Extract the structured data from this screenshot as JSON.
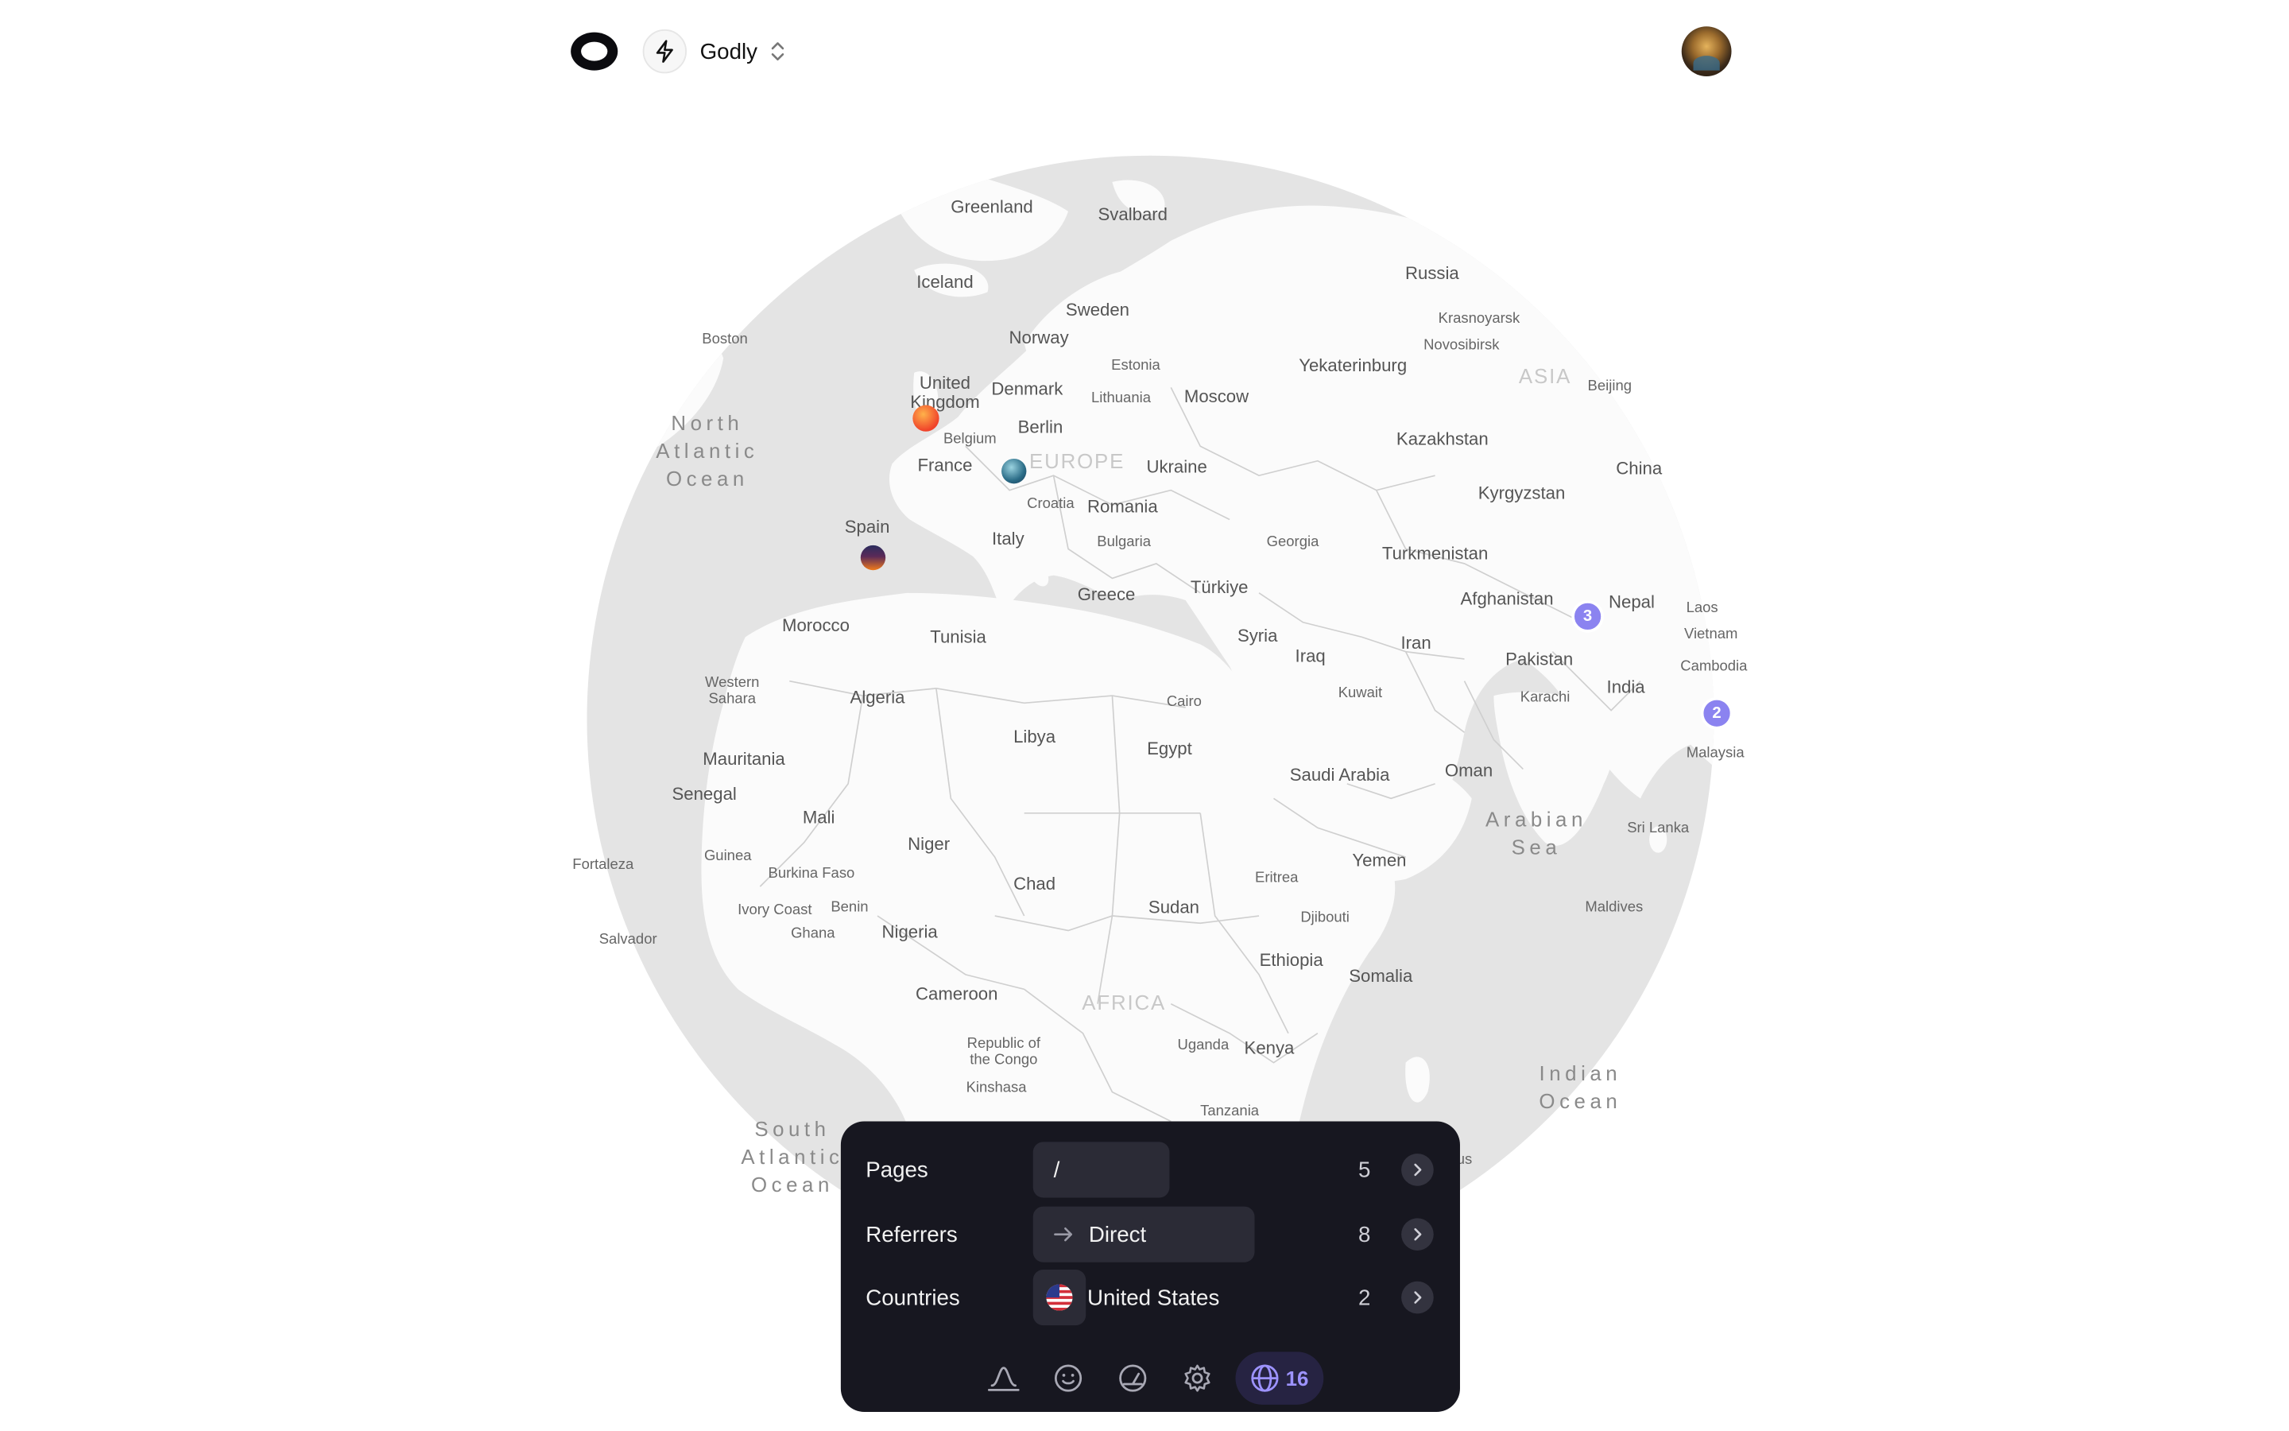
{
  "header": {
    "project_name": "Godly",
    "icons": [
      "logo-ring-icon",
      "bolt-icon",
      "chevron-updown-icon"
    ],
    "avatar": "user-avatar"
  },
  "map": {
    "labels": {
      "greenland": "Greenland",
      "svalbard": "Svalbard",
      "iceland": "Iceland",
      "russia": "Russia",
      "sweden": "Sweden",
      "norway": "Norway",
      "krasnoyarsk": "Krasnoyarsk",
      "novosibirsk": "Novosibirsk",
      "boston": "Boston",
      "estonia": "Estonia",
      "yekaterinburg": "Yekaterinburg",
      "asia": "ASIA",
      "beijing": "Beijing",
      "united_kingdom": "United Kingdom",
      "denmark": "Denmark",
      "lithuania": "Lithuania",
      "moscow": "Moscow",
      "north_atlantic": "North Atlantic Ocean",
      "berlin": "Berlin",
      "kazakhstan": "Kazakhstan",
      "belgium": "Belgium",
      "france": "France",
      "europe": "EUROPE",
      "ukraine": "Ukraine",
      "china": "China",
      "kyrgyzstan": "Kyrgyzstan",
      "croatia": "Croatia",
      "romania": "Romania",
      "spain": "Spain",
      "italy": "Italy",
      "bulgaria": "Bulgaria",
      "georgia": "Georgia",
      "turkmenistan": "Turkmenistan",
      "turkiye": "Türkiye",
      "greece": "Greece",
      "afghanistan": "Afghanistan",
      "nepal": "Nepal",
      "laos": "Laos",
      "vietnam": "Vietnam",
      "morocco": "Morocco",
      "tunisia": "Tunisia",
      "syria": "Syria",
      "iran": "Iran",
      "iraq": "Iraq",
      "pakistan": "Pakistan",
      "cambodia": "Cambodia",
      "western_sahara": "Western Sahara",
      "algeria": "Algeria",
      "kuwait": "Kuwait",
      "india": "India",
      "karachi": "Karachi",
      "cairo": "Cairo",
      "libya": "Libya",
      "egypt": "Egypt",
      "malaysia": "Malaysia",
      "mauritania": "Mauritania",
      "saudi_arabia": "Saudi Arabia",
      "oman": "Oman",
      "senegal": "Senegal",
      "mali": "Mali",
      "arabian_sea": "Arabian Sea",
      "niger": "Niger",
      "sri_lanka": "Sri Lanka",
      "yemen": "Yemen",
      "fortaleza": "Fortaleza",
      "guinea": "Guinea",
      "chad": "Chad",
      "burkina_faso": "Burkina Faso",
      "eritrea": "Eritrea",
      "sudan": "Sudan",
      "ivory_coast": "Ivory Coast",
      "benin": "Benin",
      "maldives": "Maldives",
      "djibouti": "Djibouti",
      "salvador": "Salvador",
      "ghana": "Ghana",
      "nigeria": "Nigeria",
      "ethiopia": "Ethiopia",
      "somalia": "Somalia",
      "cameroon": "Cameroon",
      "africa": "AFRICA",
      "republic_congo": "Republic of the Congo",
      "uganda": "Uganda",
      "kenya": "Kenya",
      "indian_ocean": "Indian Ocean",
      "kinshasa": "Kinshasa",
      "tanzania": "Tanzania",
      "south_atlantic": "South Atlantic Ocean",
      "mauritius_partial": "us"
    },
    "clusters": [
      {
        "name": "cluster-south-asia",
        "count": "3"
      },
      {
        "name": "cluster-southeast-asia",
        "count": "2"
      }
    ],
    "colors": {
      "land": "#ffffff",
      "sea": "#e6e6e6",
      "border": "#cfcfcf",
      "cluster": "#8b83f0"
    }
  },
  "stats_panel": {
    "rows": [
      {
        "label": "Pages",
        "value": "/",
        "count": "5"
      },
      {
        "label": "Referrers",
        "value": "Direct",
        "count": "8"
      },
      {
        "label": "Countries",
        "value": "United States",
        "count": "2"
      }
    ],
    "toolbar": {
      "items": [
        "activity-icon",
        "smiley-icon",
        "gauge-icon",
        "settings-icon",
        "globe-icon"
      ],
      "active_count": "16"
    },
    "colors": {
      "background": "#171720",
      "chip": "#2b2b36",
      "accent": "#9d93ff"
    }
  }
}
